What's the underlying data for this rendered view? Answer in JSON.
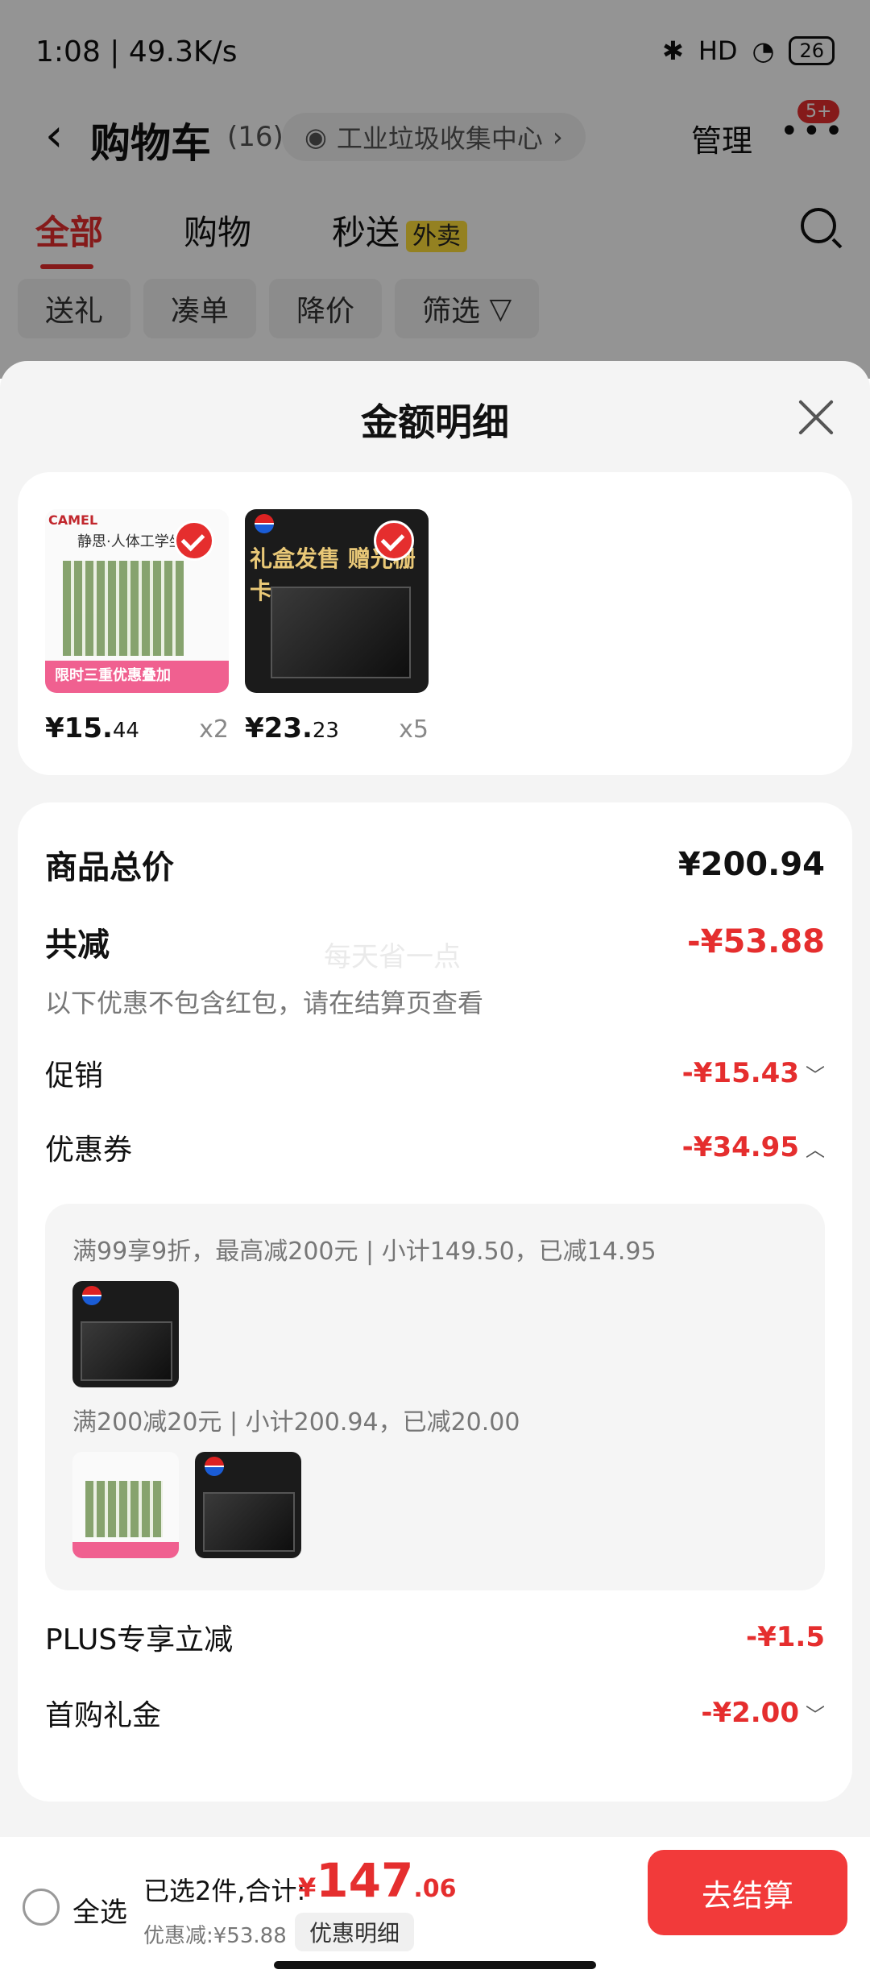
{
  "status_bar": {
    "time": "1:08 | 49.3K/s",
    "battery": "26",
    "network": "HD"
  },
  "header": {
    "back": "‹",
    "title": "购物车",
    "count": "(16)",
    "scene": "工业垃圾收集中心",
    "manage": "管理",
    "more": "•••",
    "badge": "5+"
  },
  "tabs": [
    {
      "label": "全部",
      "active": true
    },
    {
      "label": "购物",
      "active": false
    },
    {
      "label": "秒送",
      "active": false,
      "tag": "外卖"
    }
  ],
  "chips": [
    "送礼",
    "凑单",
    "降价",
    "筛选"
  ],
  "sheet": {
    "title": "金额明细",
    "products": [
      {
        "price_int": "¥15.",
        "price_dec": "44",
        "qty": "x2",
        "image_text": "静思·人体工学坐",
        "image_brand": "CAMEL",
        "image_sticker": "限时三重优惠叠加"
      },
      {
        "price_int": "¥23.",
        "price_dec": "23",
        "qty": "x5",
        "image_text": "礼盒发售 赠光栅卡"
      }
    ],
    "summary": {
      "total_label": "商品总价",
      "total_value": "¥200.94",
      "reduce_label": "共减",
      "reduce_value": "-¥53.88",
      "watermark": "每天省一点",
      "note": "以下优惠不包含红包，请在结算页查看",
      "promo_label": "促销",
      "promo_value": "-¥15.43",
      "coupon_label": "优惠券",
      "coupon_value": "-¥34.95",
      "coupon_lines": [
        "满99享9折，最高减200元 | 小计149.50，已减14.95",
        "满200减20元 | 小计200.94，已减20.00"
      ],
      "plus_label": "PLUS专享立减",
      "plus_value": "-¥1.5",
      "gift_label": "首购礼金",
      "gift_value": "-¥2.00"
    }
  },
  "bottom": {
    "select_all": "全选",
    "selected_info": "已选2件,合计:",
    "total_currency": "¥",
    "total_int": "147",
    "total_dec": ".06",
    "discount": "优惠减:¥53.88",
    "detail_button": "优惠明细",
    "checkout": "去结算"
  },
  "colors": {
    "accent": "#e52e2e",
    "checkout": "#f23a3a"
  }
}
